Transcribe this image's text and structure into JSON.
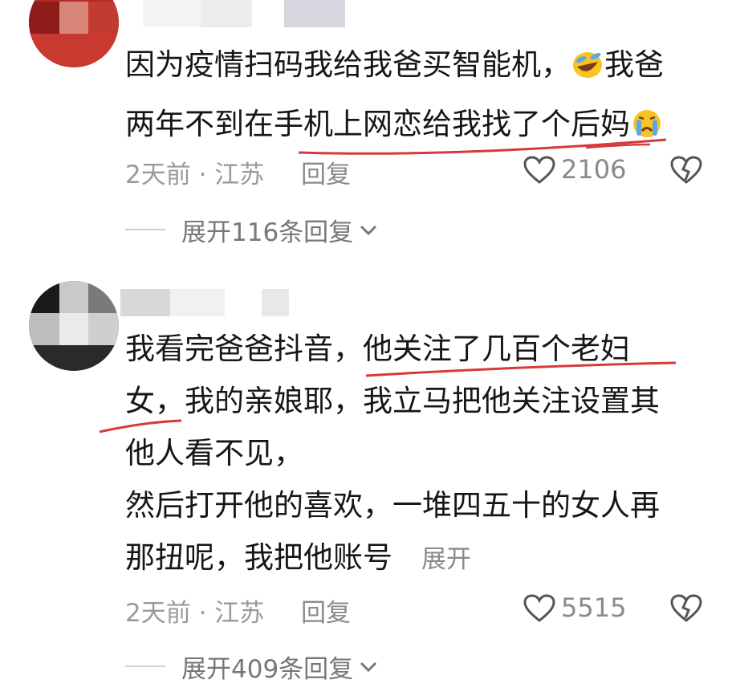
{
  "comments": [
    {
      "text_lines": [
        "因为疫情扫码我给我爸买智能机，",
        "我爸",
        "两年不到在手机上网恋给我找了个后妈"
      ],
      "emoji_1": "laughing-crying-emoji",
      "emoji_2": "crying-emoji",
      "meta": "2天前 · 江苏",
      "reply_label": "回复",
      "like_count": "2106",
      "expand_label": "展开116条回复"
    },
    {
      "text_lines": [
        "我看完爸爸抖音，他关注了几百个老妇",
        "女，我的亲娘耶，我立马把他关注设置其",
        "他人看不见，",
        "然后打开他的喜欢，一堆四五十的女人再",
        "那扭呢，我把他账号"
      ],
      "inline_expand": "展开",
      "meta": "2天前 · 江苏",
      "reply_label": "回复",
      "like_count": "5515",
      "expand_label": "展开409条回复"
    }
  ],
  "colors": {
    "annotation_red": "#d63a3a",
    "text": "#161616",
    "meta": "#9a9a9a"
  }
}
